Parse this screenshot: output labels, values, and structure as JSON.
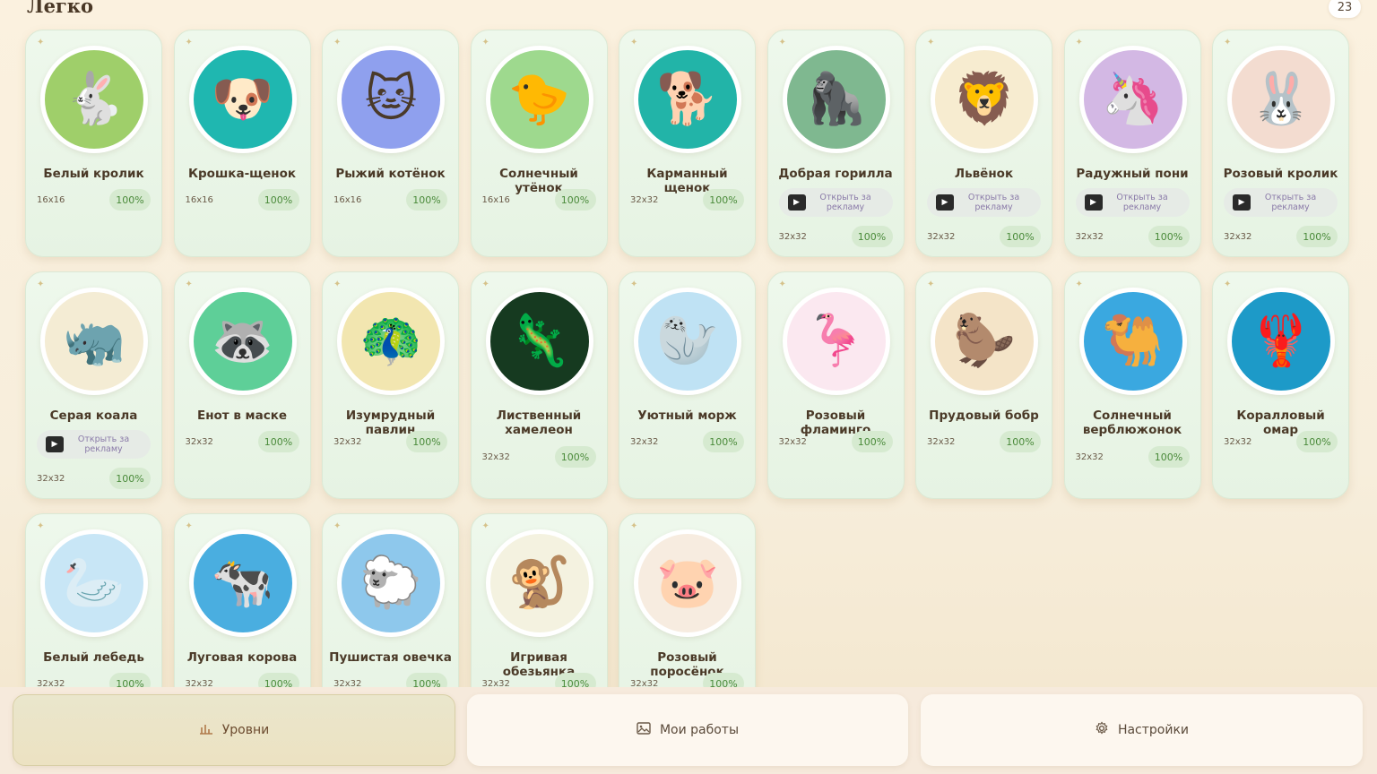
{
  "section": {
    "title": "Легко",
    "count": "23"
  },
  "ad_label": "Открыть за рекламу",
  "cards": [
    {
      "title": "Белый кролик",
      "size": "16x16",
      "progress": "100%",
      "ad": false,
      "emoji": "🐇",
      "bg": "#9fcf6a"
    },
    {
      "title": "Крошка-щенок",
      "size": "16x16",
      "progress": "100%",
      "ad": false,
      "emoji": "🐶",
      "bg": "#1fb7b0"
    },
    {
      "title": "Рыжий котёнок",
      "size": "16x16",
      "progress": "100%",
      "ad": false,
      "emoji": "🐱",
      "bg": "#8fa0ee"
    },
    {
      "title": "Солнечный утёнок",
      "size": "16x16",
      "progress": "100%",
      "ad": false,
      "emoji": "🐤",
      "bg": "#9ed98e"
    },
    {
      "title": "Карманный щенок",
      "size": "32x32",
      "progress": "100%",
      "ad": false,
      "emoji": "🐕",
      "bg": "#22b4a8"
    },
    {
      "title": "Добрая горилла",
      "size": "32x32",
      "progress": "100%",
      "ad": true,
      "emoji": "🦍",
      "bg": "#7fb890"
    },
    {
      "title": "Львёнок",
      "size": "32x32",
      "progress": "100%",
      "ad": true,
      "emoji": "🦁",
      "bg": "#f7ecd0"
    },
    {
      "title": "Радужный пони",
      "size": "32x32",
      "progress": "100%",
      "ad": true,
      "emoji": "🦄",
      "bg": "#d3b8e4"
    },
    {
      "title": "Розовый кролик",
      "size": "32x32",
      "progress": "100%",
      "ad": true,
      "emoji": "🐰",
      "bg": "#f3dcd0"
    },
    {
      "title": "Серая коала",
      "size": "32x32",
      "progress": "100%",
      "ad": true,
      "emoji": "🦏",
      "bg": "#f4ecd4"
    },
    {
      "title": "Енот в маске",
      "size": "32x32",
      "progress": "100%",
      "ad": false,
      "emoji": "🦝",
      "bg": "#5ecf98"
    },
    {
      "title": "Изумрудный павлин",
      "size": "32x32",
      "progress": "100%",
      "ad": false,
      "emoji": "🦚",
      "bg": "#f2e6b0"
    },
    {
      "title": "Лиственный хамелеон",
      "size": "32x32",
      "progress": "100%",
      "ad": false,
      "emoji": "🦎",
      "bg": "#163a20"
    },
    {
      "title": "Уютный морж",
      "size": "32x32",
      "progress": "100%",
      "ad": false,
      "emoji": "🦭",
      "bg": "#bfe2f4"
    },
    {
      "title": "Розовый фламинго",
      "size": "32x32",
      "progress": "100%",
      "ad": false,
      "emoji": "🦩",
      "bg": "#fbe8f0"
    },
    {
      "title": "Прудовый бобр",
      "size": "32x32",
      "progress": "100%",
      "ad": false,
      "emoji": "🦫",
      "bg": "#f4e4c8"
    },
    {
      "title": "Солнечный верблюжонок",
      "size": "32x32",
      "progress": "100%",
      "ad": false,
      "emoji": "🐫",
      "bg": "#3aa8e0"
    },
    {
      "title": "Коралловый омар",
      "size": "32x32",
      "progress": "100%",
      "ad": false,
      "emoji": "🦞",
      "bg": "#1d9ac8"
    },
    {
      "title": "Белый лебедь",
      "size": "32x32",
      "progress": "100%",
      "ad": false,
      "emoji": "🦢",
      "bg": "#c8e6f6"
    },
    {
      "title": "Луговая корова",
      "size": "32x32",
      "progress": "100%",
      "ad": false,
      "emoji": "🐄",
      "bg": "#4aaee0"
    },
    {
      "title": "Пушистая овечка",
      "size": "32x32",
      "progress": "100%",
      "ad": false,
      "emoji": "🐑",
      "bg": "#8ec8ec"
    },
    {
      "title": "Игривая обезьянка",
      "size": "32x32",
      "progress": "100%",
      "ad": false,
      "emoji": "🐒",
      "bg": "#f4f2e0"
    },
    {
      "title": "Розовый поросёнок",
      "size": "32x32",
      "progress": "100%",
      "ad": false,
      "emoji": "🐷",
      "bg": "#f7ece0"
    }
  ],
  "nav": {
    "levels": {
      "label": "Уровни",
      "icon": "bar-chart-icon"
    },
    "works": {
      "label": "Мои работы",
      "icon": "image-icon"
    },
    "settings": {
      "label": "Настройки",
      "icon": "gear-icon"
    }
  }
}
